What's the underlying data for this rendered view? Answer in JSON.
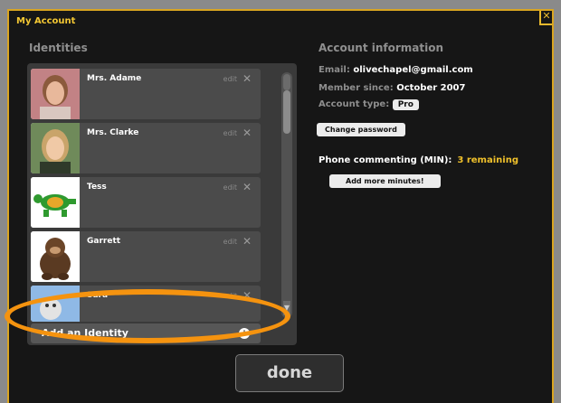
{
  "window": {
    "title": "My Account",
    "close_icon": "close-icon"
  },
  "identities": {
    "heading": "Identities",
    "edit_label": "edit",
    "delete_glyph": "✕",
    "items": [
      {
        "name": "Mrs. Adame",
        "avatar": "photo-woman-brown-hair"
      },
      {
        "name": "Mrs. Clarke",
        "avatar": "photo-woman-blonde-hair"
      },
      {
        "name": "Tess",
        "avatar": "green-turtle-drawing"
      },
      {
        "name": "Garrett",
        "avatar": "gorilla-plush"
      },
      {
        "name": "Sara",
        "avatar": "cartoon-animal"
      }
    ],
    "add_label": "Add an Identity",
    "add_icon": "plus-circle-icon"
  },
  "account": {
    "heading": "Account information",
    "email_label": "Email:",
    "email_value": "olivechapel@gmail.com",
    "member_label": "Member since:",
    "member_value": "October 2007",
    "type_label": "Account type:",
    "type_value": "Pro",
    "change_password": "Change password",
    "phone_label_prefix": "Phone commenting (",
    "phone_label_code": "MIN",
    "phone_label_suffix": "):",
    "phone_remaining": "3 remaining",
    "add_minutes": "Add more minutes!"
  },
  "footer": {
    "done_label": "done"
  },
  "colors": {
    "accent": "#f3c733",
    "highlight": "#f5930f",
    "panel": "#161616"
  }
}
